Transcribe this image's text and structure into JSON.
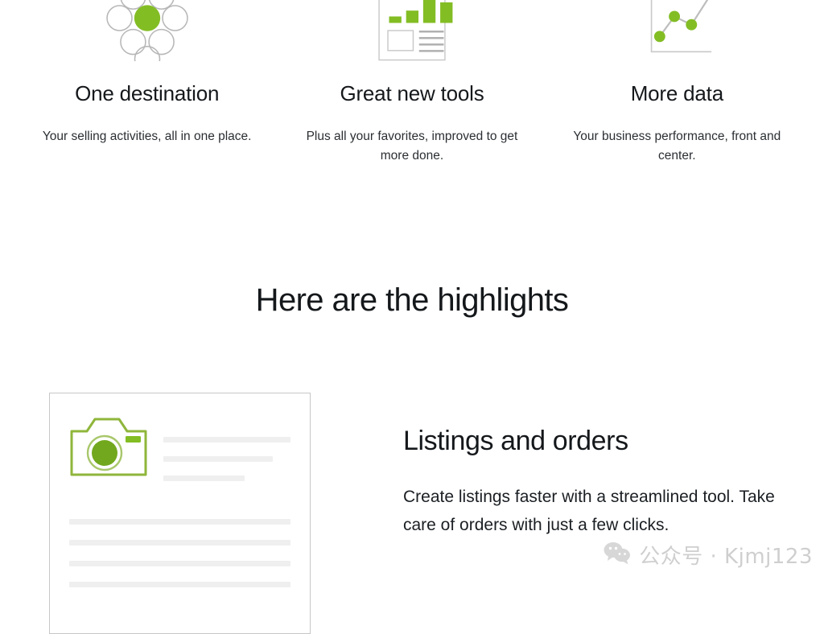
{
  "theme": {
    "accent_green": "#83bd24",
    "icon_gray": "#b7b7b7",
    "skeleton_gray": "#efefef",
    "card_border": "#c7c7c7",
    "text_dark": "#15181b",
    "background": "#ffffff"
  },
  "features": [
    {
      "icon": "circle-cluster-icon",
      "title": "One destination",
      "description": "Your selling activities, all in one place."
    },
    {
      "icon": "report-document-icon",
      "title": "Great new tools",
      "description": "Plus all your favorites, improved to get more done."
    },
    {
      "icon": "line-chart-icon",
      "title": "More data",
      "description": "Your business performance, front and center."
    }
  ],
  "section": {
    "heading": "Here are the highlights"
  },
  "highlight": {
    "card": {
      "icon": "camera-icon",
      "right_lines": 3,
      "bottom_lines": 4
    },
    "title": "Listings and orders",
    "description": "Create listings faster with a streamlined tool. Take care of orders with just a few clicks."
  },
  "watermark": {
    "icon": "wechat-icon",
    "text": "公众号 · Kjmj123"
  }
}
